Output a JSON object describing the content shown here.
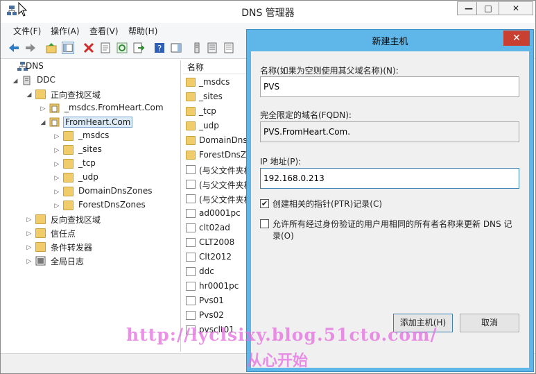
{
  "window": {
    "title": "DNS 管理器",
    "controls": {
      "minimize": "—",
      "restore": "□",
      "close": "✕"
    }
  },
  "menu": [
    "文件(F)",
    "操作(A)",
    "查看(V)",
    "帮助(H)"
  ],
  "tree": [
    {
      "label": "DNS",
      "toggle": "",
      "icon": "dns-server-icon"
    },
    {
      "label": "DDC",
      "toggle": "◢",
      "icon": "server-icon"
    },
    {
      "label": "正向查找区域",
      "toggle": "◢",
      "icon": "folder-icon"
    },
    {
      "label": "_msdcs.FromHeart.Com",
      "toggle": "▷",
      "icon": "zone-icon"
    },
    {
      "label": "FromHeart.Com",
      "toggle": "◢",
      "icon": "zone-icon",
      "selected": true
    },
    {
      "label": "_msdcs",
      "toggle": "▷",
      "icon": "folder-icon"
    },
    {
      "label": "_sites",
      "toggle": "▷",
      "icon": "folder-icon"
    },
    {
      "label": "_tcp",
      "toggle": "▷",
      "icon": "folder-icon"
    },
    {
      "label": "_udp",
      "toggle": "▷",
      "icon": "folder-icon"
    },
    {
      "label": "DomainDnsZones",
      "toggle": "▷",
      "icon": "folder-icon"
    },
    {
      "label": "ForestDnsZones",
      "toggle": "▷",
      "icon": "folder-icon"
    },
    {
      "label": "反向查找区域",
      "toggle": "▷",
      "icon": "folder-icon"
    },
    {
      "label": "信任点",
      "toggle": "▷",
      "icon": "folder-icon"
    },
    {
      "label": "条件转发器",
      "toggle": "▷",
      "icon": "folder-icon"
    },
    {
      "label": "全局日志",
      "toggle": "▷",
      "icon": "log-icon"
    }
  ],
  "list": {
    "header": "名称",
    "rows": [
      {
        "label": "_msdcs",
        "icon": "folder-icon"
      },
      {
        "label": "_sites",
        "icon": "folder-icon"
      },
      {
        "label": "_tcp",
        "icon": "folder-icon"
      },
      {
        "label": "_udp",
        "icon": "folder-icon"
      },
      {
        "label": "DomainDnsZ",
        "icon": "folder-icon"
      },
      {
        "label": "ForestDnsZo",
        "icon": "folder-icon"
      },
      {
        "label": "(与父文件夹相",
        "icon": "record-icon"
      },
      {
        "label": "(与父文件夹相",
        "icon": "record-icon"
      },
      {
        "label": "(与父文件夹相",
        "icon": "record-icon"
      },
      {
        "label": "ad0001pc",
        "icon": "record-icon"
      },
      {
        "label": "clt02ad",
        "icon": "record-icon"
      },
      {
        "label": "CLT2008",
        "icon": "record-icon"
      },
      {
        "label": "Clt2012",
        "icon": "record-icon"
      },
      {
        "label": "ddc",
        "icon": "record-icon"
      },
      {
        "label": "hr0001pc",
        "icon": "record-icon"
      },
      {
        "label": "Pvs01",
        "icon": "record-icon"
      },
      {
        "label": "Pvs02",
        "icon": "record-icon"
      },
      {
        "label": "pvsclt01",
        "icon": "record-icon"
      }
    ]
  },
  "dialog": {
    "title": "新建主机",
    "close": "✕",
    "name_label": "名称(如果为空则使用其父域名称)(N):",
    "name_value": "PVS",
    "fqdn_label": "完全限定的域名(FQDN):",
    "fqdn_value": "PVS.FromHeart.Com.",
    "ip_label": "IP 地址(P):",
    "ip_value": "192.168.0.213",
    "ptr_label": "创建相关的指针(PTR)记录(C)",
    "ptr_checked": true,
    "allow_label_line1": "允许所有经过身份验证的用户用相同的所有者名称来更新 DNS 记",
    "allow_label_line2": "录(O)",
    "allow_checked": false,
    "add_button": "添加主机(H)",
    "cancel_button": "取消"
  },
  "watermark": {
    "url": "http://lyclsixy.blog.51cto.com/",
    "text": "从心开始"
  }
}
